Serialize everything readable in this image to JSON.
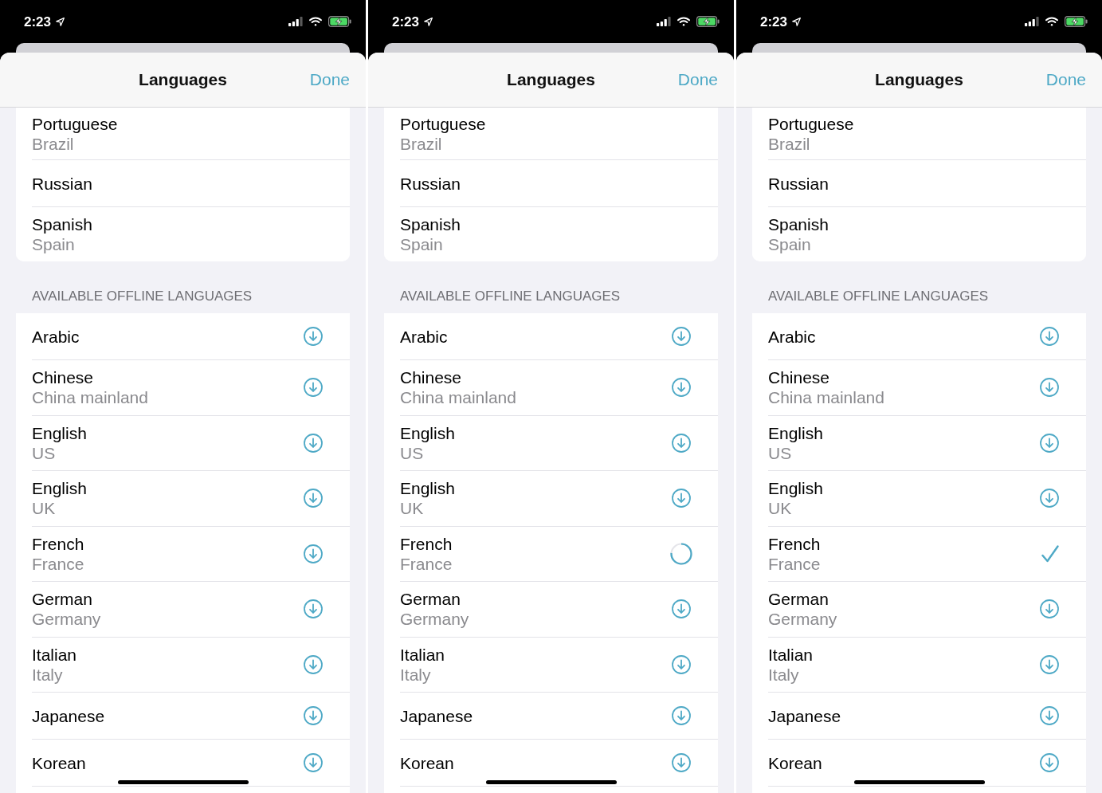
{
  "screens": [
    {
      "status_bar": {
        "time": "2:23"
      },
      "nav_bar": {
        "title": "Languages",
        "done": "Done"
      },
      "languages": [
        {
          "name": "Portuguese",
          "region": "Brazil"
        },
        {
          "name": "Russian"
        },
        {
          "name": "Spanish",
          "region": "Spain"
        }
      ],
      "offline_section": {
        "header": "AVAILABLE OFFLINE LANGUAGES",
        "languages": [
          {
            "name": "Arabic",
            "kind": "download"
          },
          {
            "name": "Chinese",
            "region": "China mainland",
            "kind": "download"
          },
          {
            "name": "English",
            "region": "US",
            "kind": "download"
          },
          {
            "name": "English",
            "region": "UK",
            "kind": "download"
          },
          {
            "name": "French",
            "region": "France",
            "kind": "download"
          },
          {
            "name": "German",
            "region": "Germany",
            "kind": "download"
          },
          {
            "name": "Italian",
            "region": "Italy",
            "kind": "download"
          },
          {
            "name": "Japanese",
            "kind": "download"
          },
          {
            "name": "Korean",
            "kind": "download"
          }
        ]
      }
    },
    {
      "status_bar": {
        "time": "2:23"
      },
      "nav_bar": {
        "title": "Languages",
        "done": "Done"
      },
      "languages": [
        {
          "name": "Portuguese",
          "region": "Brazil"
        },
        {
          "name": "Russian"
        },
        {
          "name": "Spanish",
          "region": "Spain"
        }
      ],
      "offline_section": {
        "header": "AVAILABLE OFFLINE LANGUAGES",
        "languages": [
          {
            "name": "Arabic",
            "kind": "download"
          },
          {
            "name": "Chinese",
            "region": "China mainland",
            "kind": "download"
          },
          {
            "name": "English",
            "region": "US",
            "kind": "download"
          },
          {
            "name": "English",
            "region": "UK",
            "kind": "download"
          },
          {
            "name": "French",
            "region": "France",
            "kind": "loading"
          },
          {
            "name": "German",
            "region": "Germany",
            "kind": "download"
          },
          {
            "name": "Italian",
            "region": "Italy",
            "kind": "download"
          },
          {
            "name": "Japanese",
            "kind": "download"
          },
          {
            "name": "Korean",
            "kind": "download"
          }
        ]
      }
    },
    {
      "status_bar": {
        "time": "2:23"
      },
      "nav_bar": {
        "title": "Languages",
        "done": "Done"
      },
      "languages": [
        {
          "name": "Portuguese",
          "region": "Brazil"
        },
        {
          "name": "Russian"
        },
        {
          "name": "Spanish",
          "region": "Spain"
        }
      ],
      "offline_section": {
        "header": "AVAILABLE OFFLINE LANGUAGES",
        "languages": [
          {
            "name": "Arabic",
            "kind": "download"
          },
          {
            "name": "Chinese",
            "region": "China mainland",
            "kind": "download"
          },
          {
            "name": "English",
            "region": "US",
            "kind": "download"
          },
          {
            "name": "English",
            "region": "UK",
            "kind": "download"
          },
          {
            "name": "French",
            "region": "France",
            "kind": "downloaded"
          },
          {
            "name": "German",
            "region": "Germany",
            "kind": "download"
          },
          {
            "name": "Italian",
            "region": "Italy",
            "kind": "download"
          },
          {
            "name": "Japanese",
            "kind": "download"
          },
          {
            "name": "Korean",
            "kind": "download"
          }
        ]
      }
    }
  ]
}
